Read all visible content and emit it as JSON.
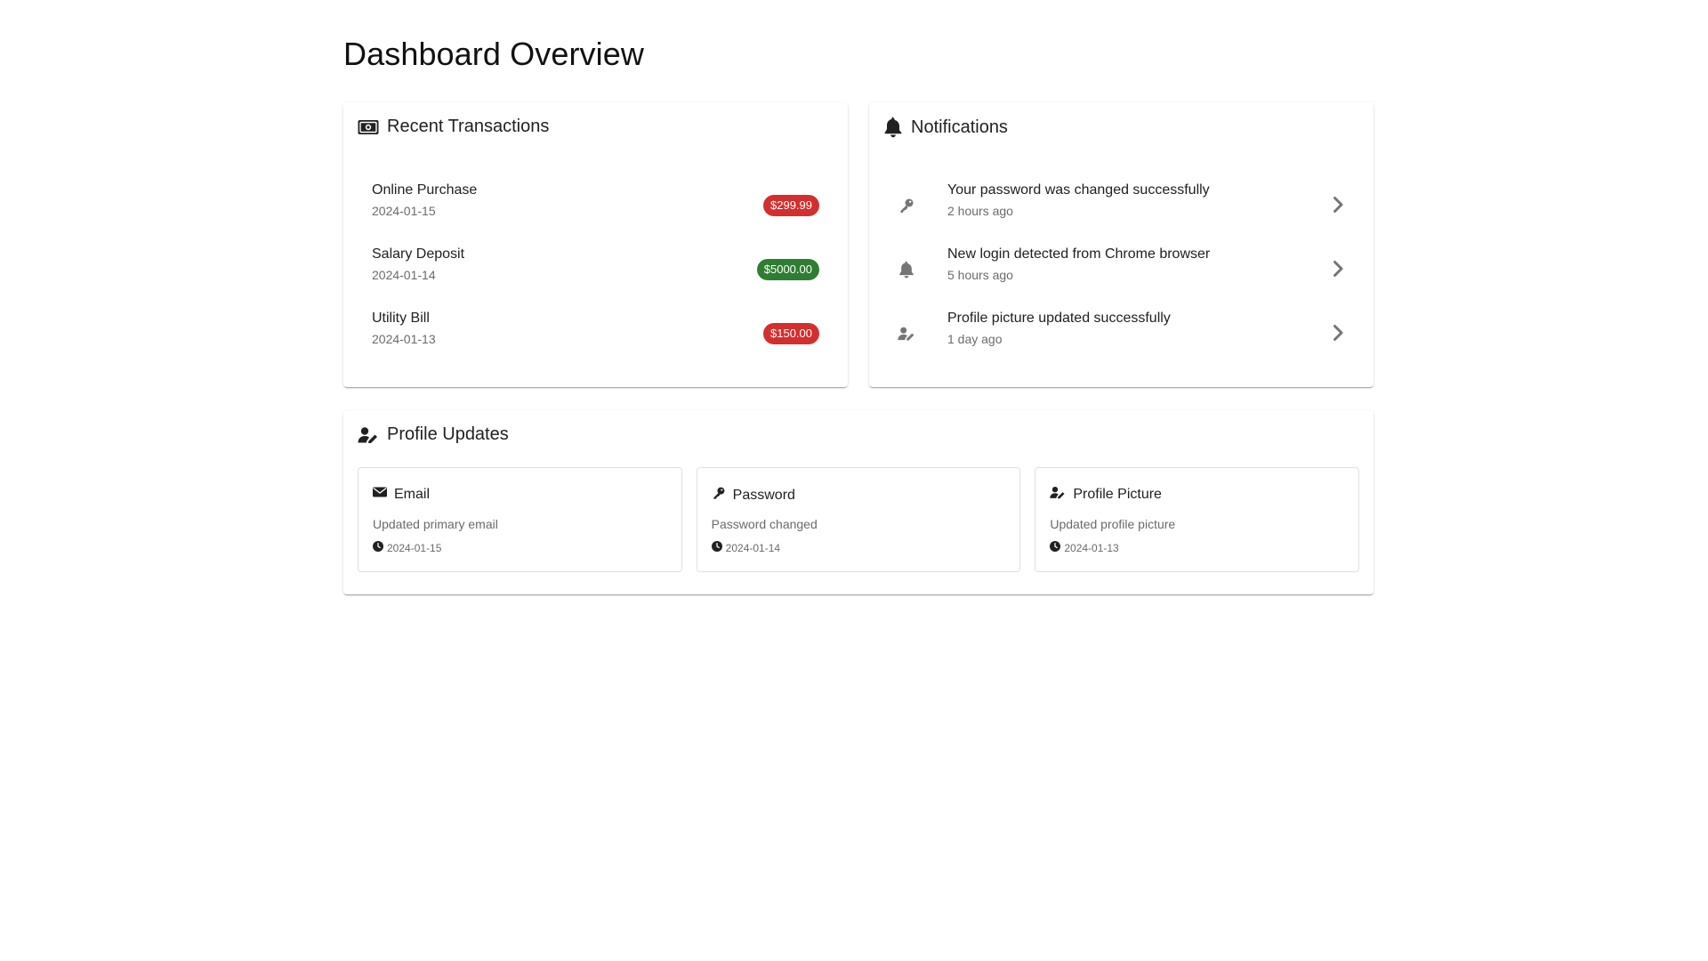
{
  "page": {
    "title": "Dashboard Overview"
  },
  "transactions": {
    "title": "Recent Transactions",
    "icon": "money-bill-icon",
    "items": [
      {
        "label": "Online Purchase",
        "date": "2024-01-15",
        "amount": "$299.99",
        "type": "debit"
      },
      {
        "label": "Salary Deposit",
        "date": "2024-01-14",
        "amount": "$5000.00",
        "type": "credit"
      },
      {
        "label": "Utility Bill",
        "date": "2024-01-13",
        "amount": "$150.00",
        "type": "debit"
      }
    ]
  },
  "notifications": {
    "title": "Notifications",
    "icon": "bell-icon",
    "items": [
      {
        "message": "Your password was changed successfully",
        "time": "2 hours ago",
        "icon": "key-icon"
      },
      {
        "message": "New login detected from Chrome browser",
        "time": "5 hours ago",
        "icon": "bell-icon"
      },
      {
        "message": "Profile picture updated successfully",
        "time": "1 day ago",
        "icon": "user-edit-icon"
      }
    ]
  },
  "profile_updates": {
    "title": "Profile Updates",
    "icon": "user-edit-icon",
    "items": [
      {
        "title": "Email",
        "description": "Updated primary email",
        "date": "2024-01-15",
        "icon": "envelope-icon"
      },
      {
        "title": "Password",
        "description": "Password changed",
        "date": "2024-01-14",
        "icon": "key-icon"
      },
      {
        "title": "Profile Picture",
        "description": "Updated profile picture",
        "date": "2024-01-13",
        "icon": "user-edit-icon"
      }
    ]
  },
  "colors": {
    "debit": "#d32f2f",
    "credit": "#2e7d32",
    "icon_muted": "#757575"
  }
}
